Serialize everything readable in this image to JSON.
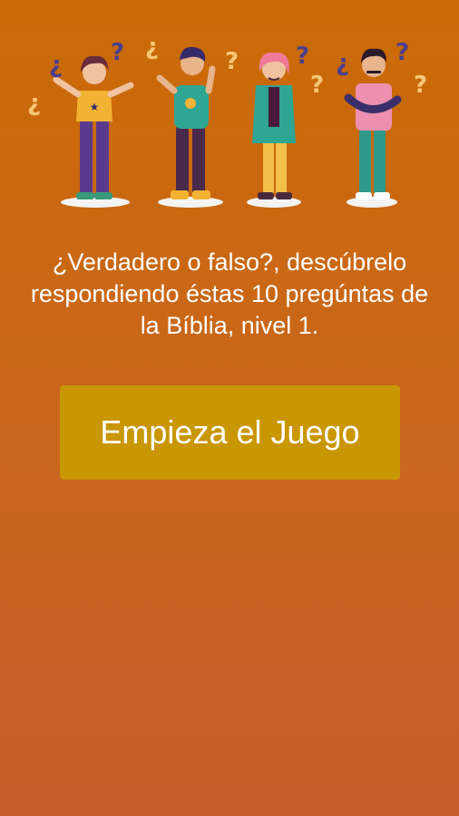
{
  "hero": {
    "illustration": "four-confused-people-with-question-marks",
    "glyph_question": "?",
    "glyph_inverted_question": "¿"
  },
  "intro": {
    "text": "¿Verdadero o falso?, descúbrelo respondiendo éstas 10 pregúntas de la Bíblia, nivel 1."
  },
  "start_button": {
    "label": "Empieza el Juego"
  },
  "colors": {
    "background_top": "#ca6a06",
    "background_bottom": "#c65e2e",
    "button": "#c99604",
    "text": "#ffffff",
    "question_mark": "#f6c978",
    "question_mark_dark": "#4a3f8e"
  }
}
